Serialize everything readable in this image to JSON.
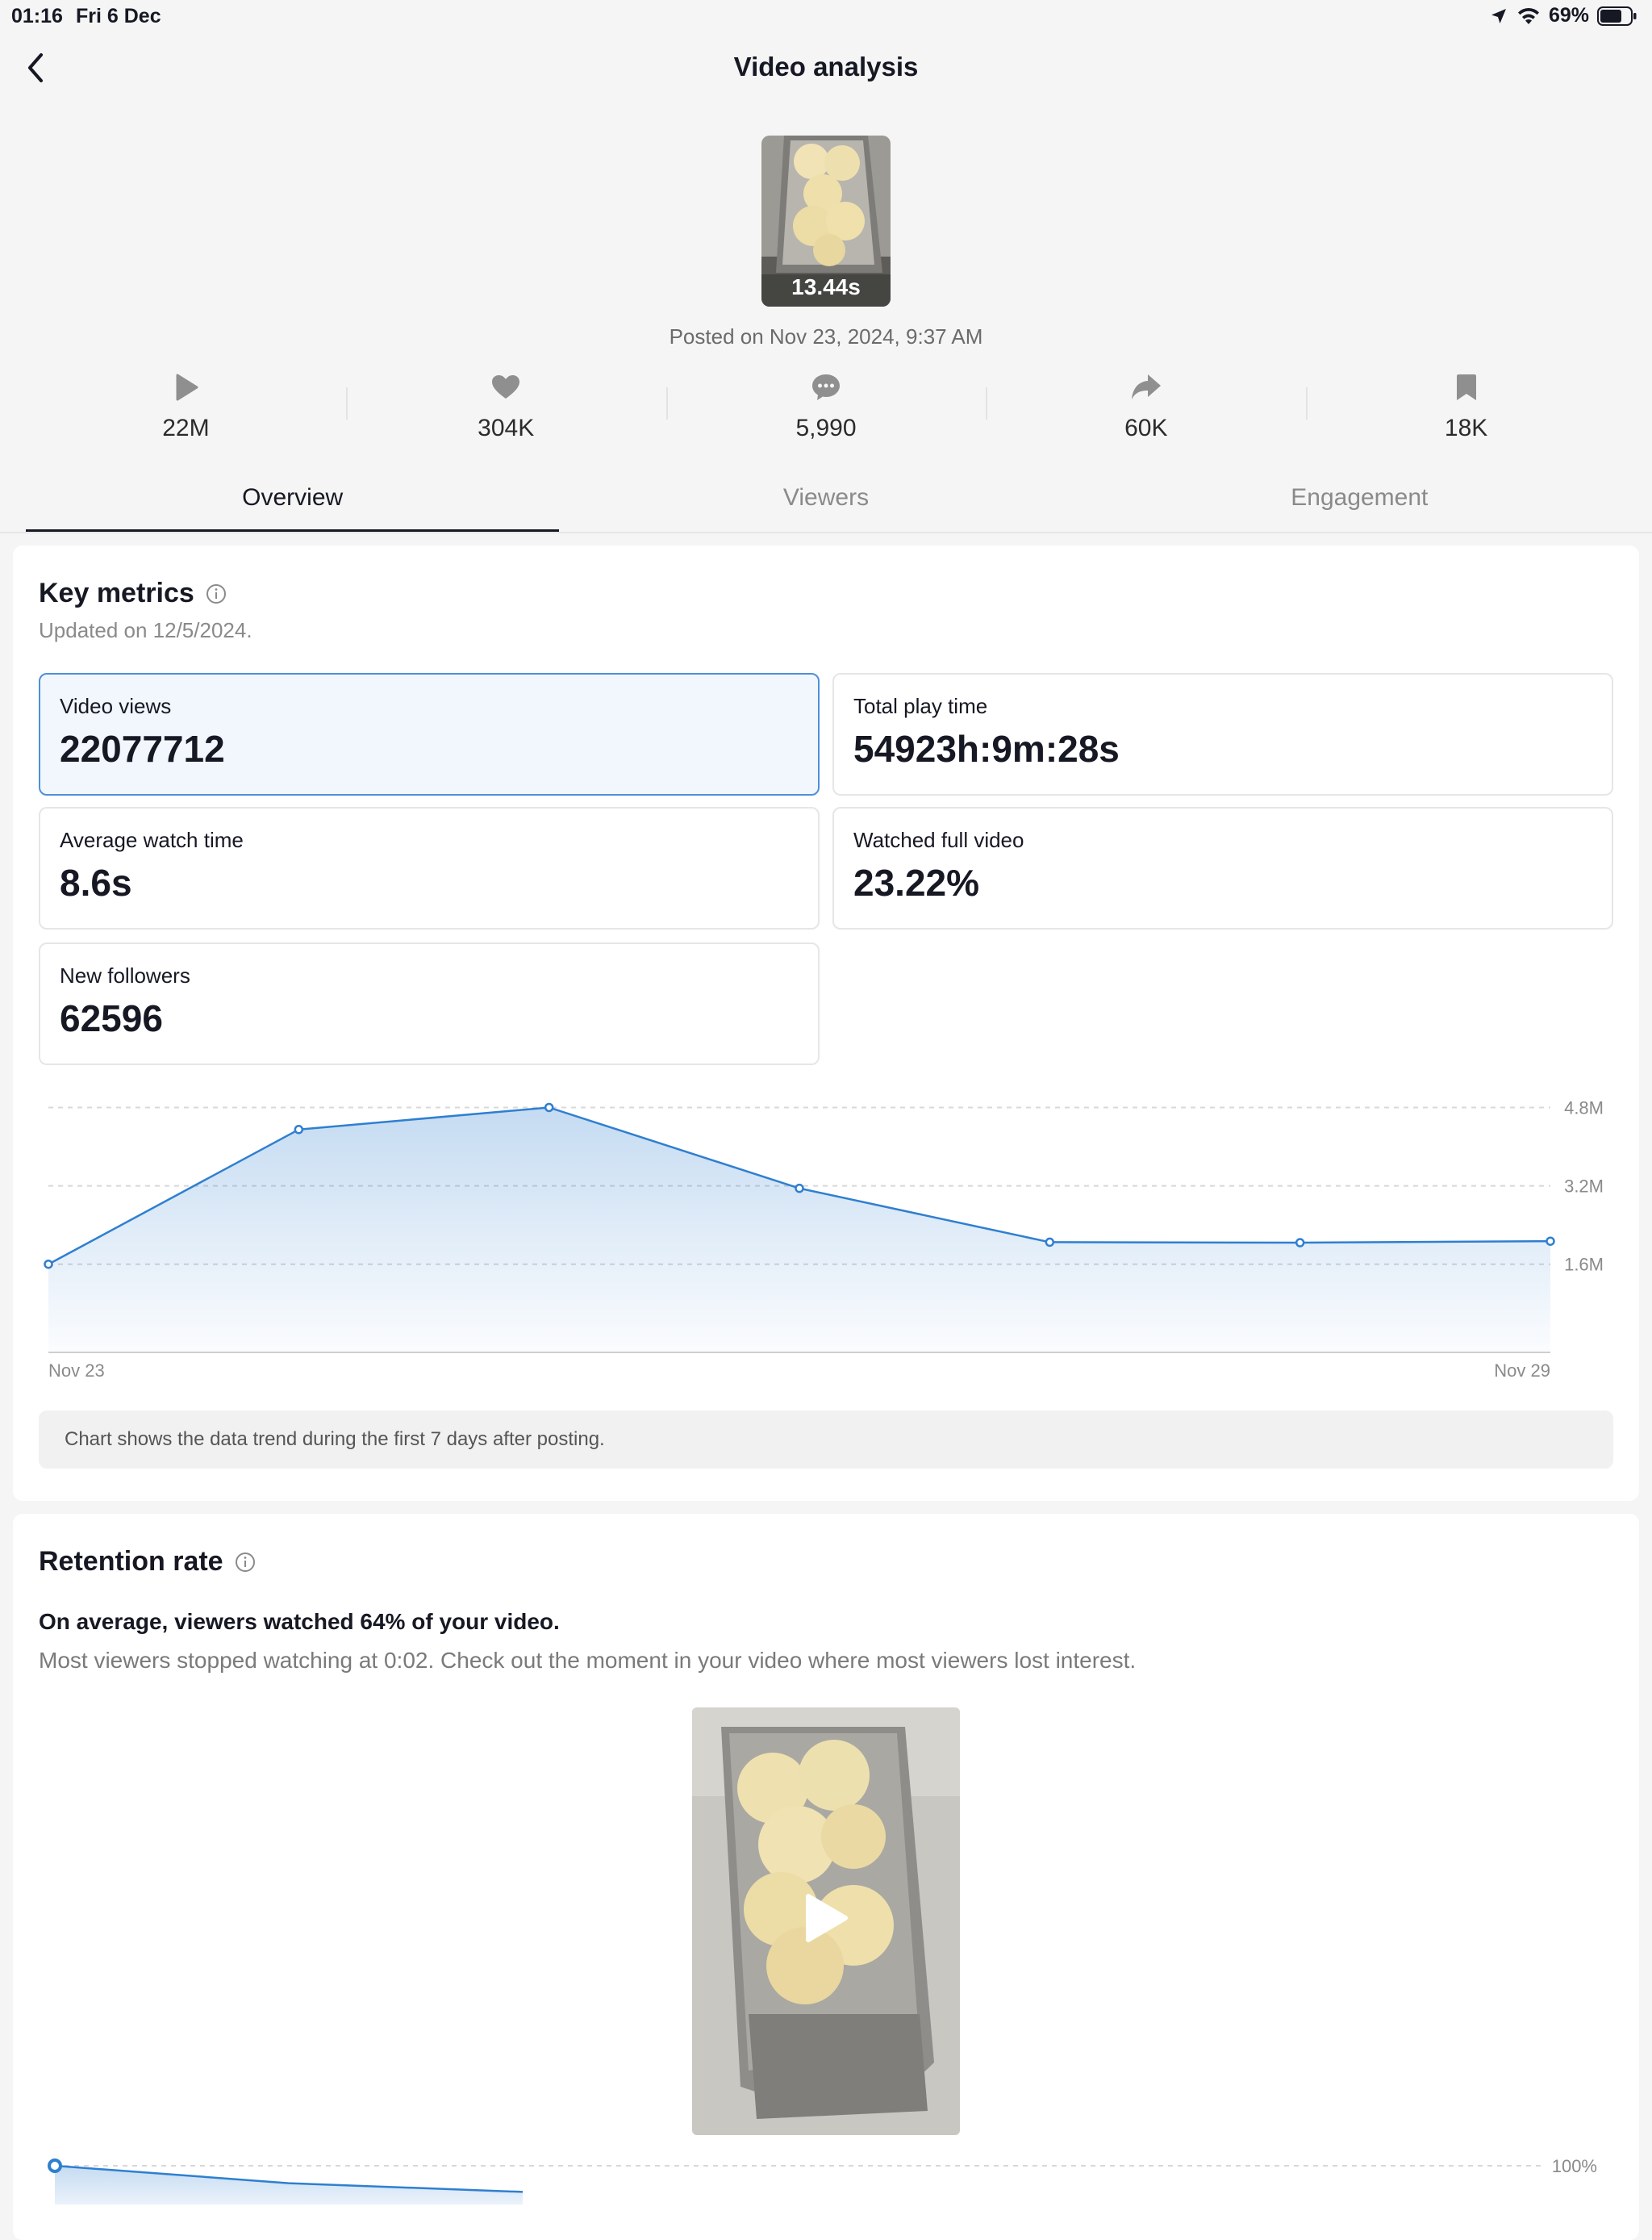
{
  "status": {
    "time": "01:16",
    "date": "Fri 6 Dec",
    "battery": "69%"
  },
  "header": {
    "title": "Video analysis"
  },
  "video": {
    "duration": "13.44s",
    "posted": "Posted on Nov 23, 2024, 9:37 AM"
  },
  "stats": [
    {
      "icon": "play-icon",
      "value": "22M"
    },
    {
      "icon": "heart-icon",
      "value": "304K"
    },
    {
      "icon": "comment-icon",
      "value": "5,990"
    },
    {
      "icon": "share-icon",
      "value": "60K"
    },
    {
      "icon": "bookmark-icon",
      "value": "18K"
    }
  ],
  "tabs": [
    {
      "label": "Overview",
      "active": true
    },
    {
      "label": "Viewers",
      "active": false
    },
    {
      "label": "Engagement",
      "active": false
    }
  ],
  "key_metrics": {
    "title": "Key metrics",
    "updated": "Updated on 12/5/2024.",
    "metrics": [
      {
        "label": "Video views",
        "value": "22077712"
      },
      {
        "label": "Total play time",
        "value": "54923h:9m:28s"
      },
      {
        "label": "Average watch time",
        "value": "8.6s"
      },
      {
        "label": "Watched full video",
        "value": "23.22%"
      },
      {
        "label": "New followers",
        "value": "62596"
      }
    ],
    "chart_note": "Chart shows the data trend during the first 7 days after posting."
  },
  "chart_data": [
    {
      "type": "area",
      "x": [
        "Nov 23",
        "Nov 24",
        "Nov 25",
        "Nov 26",
        "Nov 27",
        "Nov 28",
        "Nov 29"
      ],
      "x_tick_labels": [
        "Nov 23",
        "Nov 29"
      ],
      "values": [
        1600000,
        4350000,
        4800000,
        3150000,
        2050000,
        2040000,
        2070000
      ],
      "y_tick_labels": [
        "4.8M",
        "3.2M",
        "1.6M"
      ],
      "y_ticks": [
        4800000,
        3200000,
        1600000
      ],
      "ylim": [
        -200000,
        5500000
      ],
      "grid": true,
      "color": "#2f7fd0"
    },
    {
      "type": "area",
      "x": [
        0,
        1,
        2
      ],
      "values": [
        100,
        94,
        91
      ],
      "y_tick_labels": [
        "100%"
      ],
      "y_ticks": [
        100
      ],
      "color": "#2f7fd0"
    }
  ],
  "retention": {
    "title": "Retention rate",
    "summary": "On average, viewers watched 64% of your video.",
    "detail": "Most viewers stopped watching at 0:02. Check out the moment in your video where most viewers lost interest."
  },
  "colors": {
    "accent": "#2f7fd0",
    "active_metric_bg": "#f2f7fd",
    "active_metric_border": "#4f8fd9"
  }
}
